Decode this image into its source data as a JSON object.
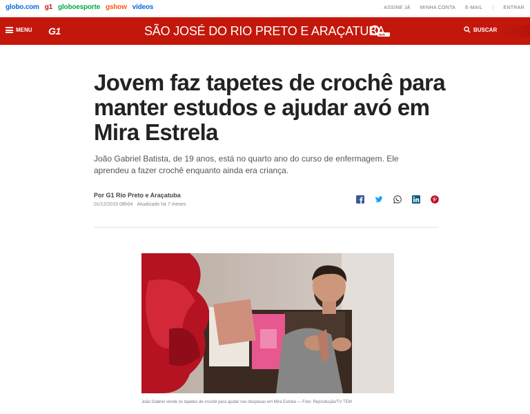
{
  "topbar": {
    "brands": [
      "globo.com",
      "g1",
      "globoesporte",
      "gshow",
      "vídeos"
    ],
    "user_links": [
      "ASSINE JÁ",
      "MINHA CONTA",
      "E-MAIL",
      "ENTRAR"
    ]
  },
  "header": {
    "menu_label": "MENU",
    "logo": "G1",
    "region": "SÃO JOSÉ DO RIO PRETO E ARAÇATUBA",
    "search_label": "BUSCAR"
  },
  "article": {
    "headline": "Jovem faz tapetes de crochê para manter estudos e ajudar avó em Mira Estrela",
    "subtitle": "João Gabriel Batista, de 19 anos, está no quarto ano do curso de enfermagem. Ele aprendeu a fazer crochê enquanto ainda era criança.",
    "byline": "Por G1 Rio Preto e Araçatuba",
    "published": "01/12/2019 08h04",
    "updated": "Atualizado há 7 meses",
    "share_icons": [
      "facebook-icon",
      "twitter-icon",
      "whatsapp-icon",
      "linkedin-icon",
      "pinterest-icon"
    ],
    "caption": "João Gabriel vende os tapetes de crochê para ajudar nas despesas em Mira Estrela — Foto: Reprodução/TV TEM"
  },
  "colors": {
    "brand_red": "#c4170c",
    "headline": "#222222",
    "facebook": "#3b5998",
    "twitter": "#1da1f2",
    "whatsapp": "#25d366",
    "linkedin": "#0077b5",
    "pinterest": "#bd081c"
  }
}
